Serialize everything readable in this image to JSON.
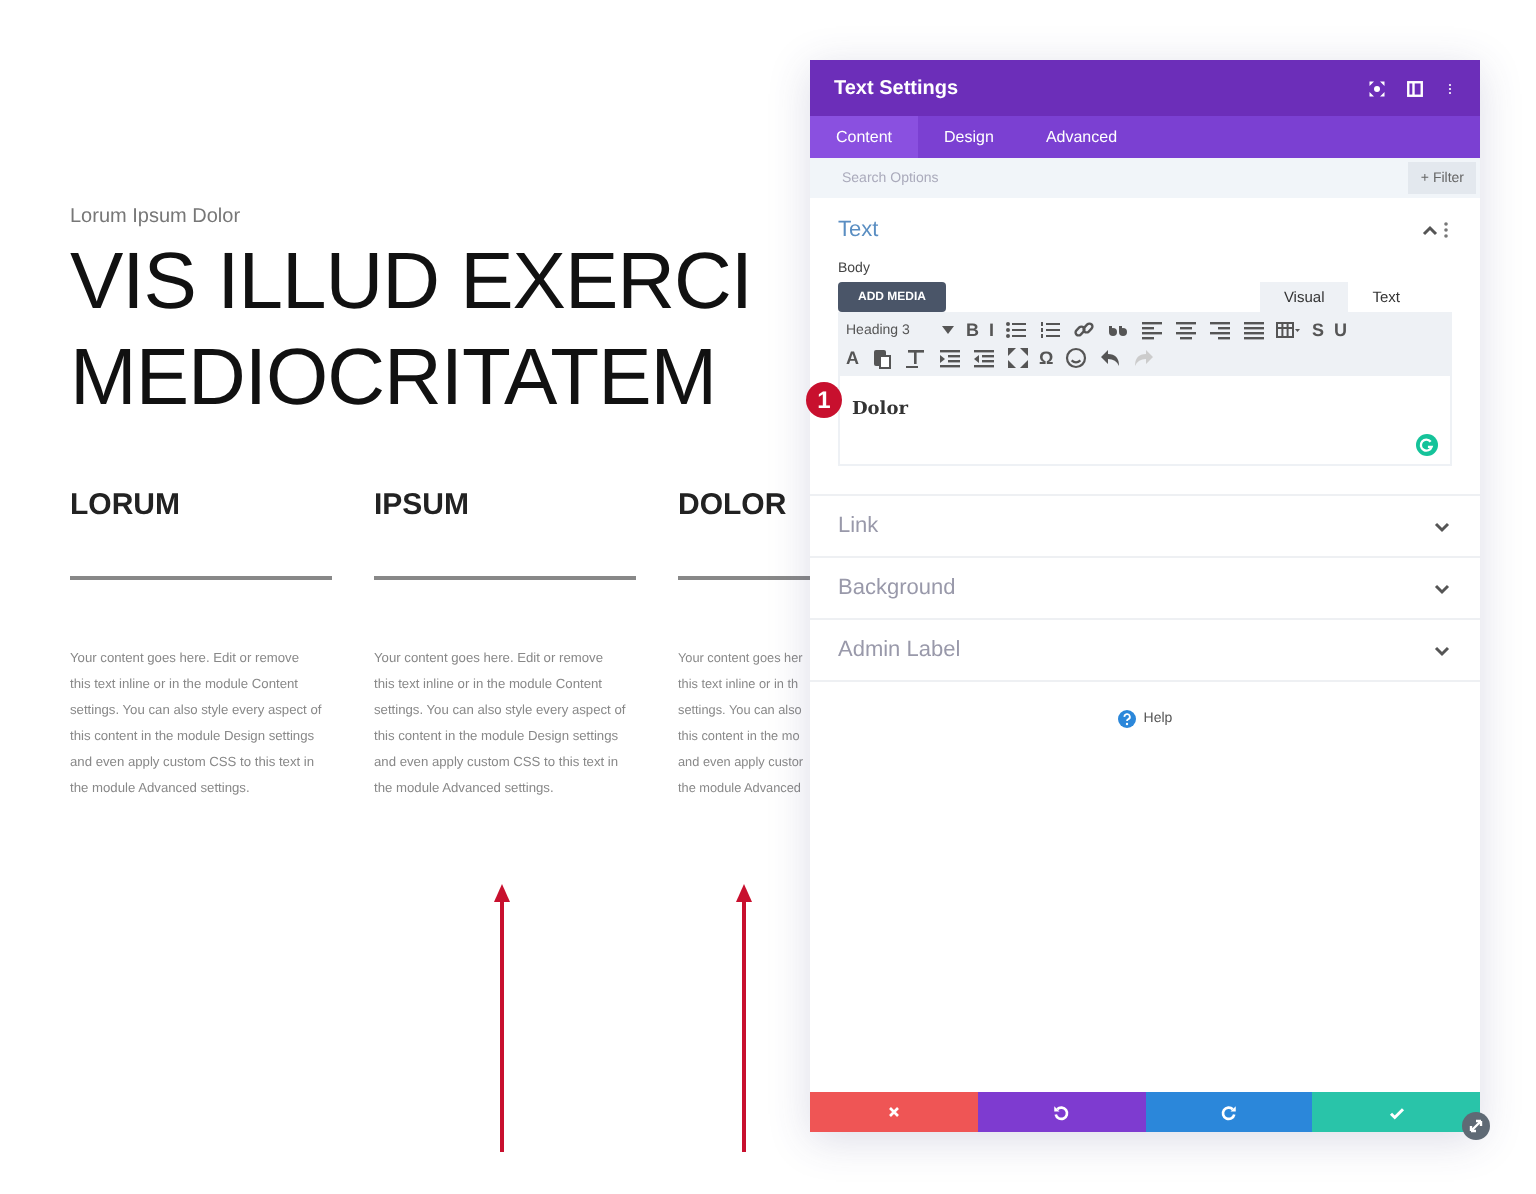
{
  "page": {
    "subtitle": "Lorum Ipsum Dolor",
    "heading_lines": [
      "VIS ILLUD EXERCI",
      "MEDIOCRITATEM"
    ],
    "columns": [
      {
        "title": "LORUM",
        "lines": [
          "Your content goes here. Edit or remove",
          "this text inline or in the module Content",
          "settings. You can also style every aspect of",
          "this content in the module Design settings",
          "and even apply custom CSS to this text in",
          "the module Advanced settings."
        ]
      },
      {
        "title": "IPSUM",
        "lines": [
          "Your content goes here. Edit or remove",
          "this text inline or in the module Content",
          "settings. You can also style every aspect of",
          "this content in the module Design settings",
          "and even apply custom CSS to this text in",
          "the module Advanced settings."
        ]
      },
      {
        "title": "DOLOR",
        "lines": [
          "Your content goes her",
          "this text inline or in th",
          "settings. You can also",
          "this content in the mo",
          "and even apply custor",
          "the module Advanced"
        ]
      }
    ]
  },
  "panel": {
    "title": "Text Settings",
    "tabs": [
      {
        "label": "Content",
        "selected": true
      },
      {
        "label": "Design",
        "selected": false
      },
      {
        "label": "Advanced",
        "selected": false
      }
    ],
    "search": {
      "placeholder": "Search Options",
      "filter_button": "+ Filter"
    },
    "text_section": {
      "title": "Text",
      "expanded": true,
      "body_label": "Body",
      "add_media": "ADD MEDIA",
      "editor_tabs": [
        {
          "label": "Visual",
          "selected": true
        },
        {
          "label": "Text",
          "selected": false
        }
      ],
      "toolbar_rows": [
        [
          {
            "kind": "select",
            "label": "Heading 3",
            "disabled": false
          },
          {
            "kind": "glyph",
            "label": "B",
            "disabled": false
          },
          {
            "kind": "glyph",
            "label": "I",
            "disabled": false
          },
          {
            "kind": "icon",
            "disabled": false
          },
          {
            "kind": "icon",
            "disabled": false
          },
          {
            "kind": "icon",
            "disabled": false
          },
          {
            "kind": "icon",
            "disabled": false
          },
          {
            "kind": "icon",
            "disabled": false
          },
          {
            "kind": "icon",
            "disabled": false
          },
          {
            "kind": "icon",
            "disabled": false
          },
          {
            "kind": "icon",
            "disabled": false
          },
          {
            "kind": "icon",
            "disabled": false
          },
          {
            "kind": "glyph",
            "label": "S",
            "disabled": false
          },
          {
            "kind": "glyph",
            "label": "U",
            "disabled": false
          }
        ],
        [
          {
            "kind": "glyph",
            "label": "A",
            "disabled": false
          },
          {
            "kind": "icon",
            "disabled": false
          },
          {
            "kind": "icon",
            "disabled": false
          },
          {
            "kind": "icon",
            "disabled": false
          },
          {
            "kind": "icon",
            "disabled": false
          },
          {
            "kind": "icon",
            "disabled": false
          },
          {
            "kind": "glyph",
            "label": "Ω",
            "disabled": false
          },
          {
            "kind": "icon",
            "disabled": false
          },
          {
            "kind": "icon",
            "disabled": false
          },
          {
            "kind": "icon",
            "disabled": true
          }
        ]
      ],
      "editor_content": "Dolor"
    },
    "collapsed_sections": [
      {
        "title": "Link",
        "expanded": false
      },
      {
        "title": "Background",
        "expanded": false
      },
      {
        "title": "Admin Label",
        "expanded": false
      }
    ],
    "help": "Help"
  },
  "annotation_badge": "1"
}
